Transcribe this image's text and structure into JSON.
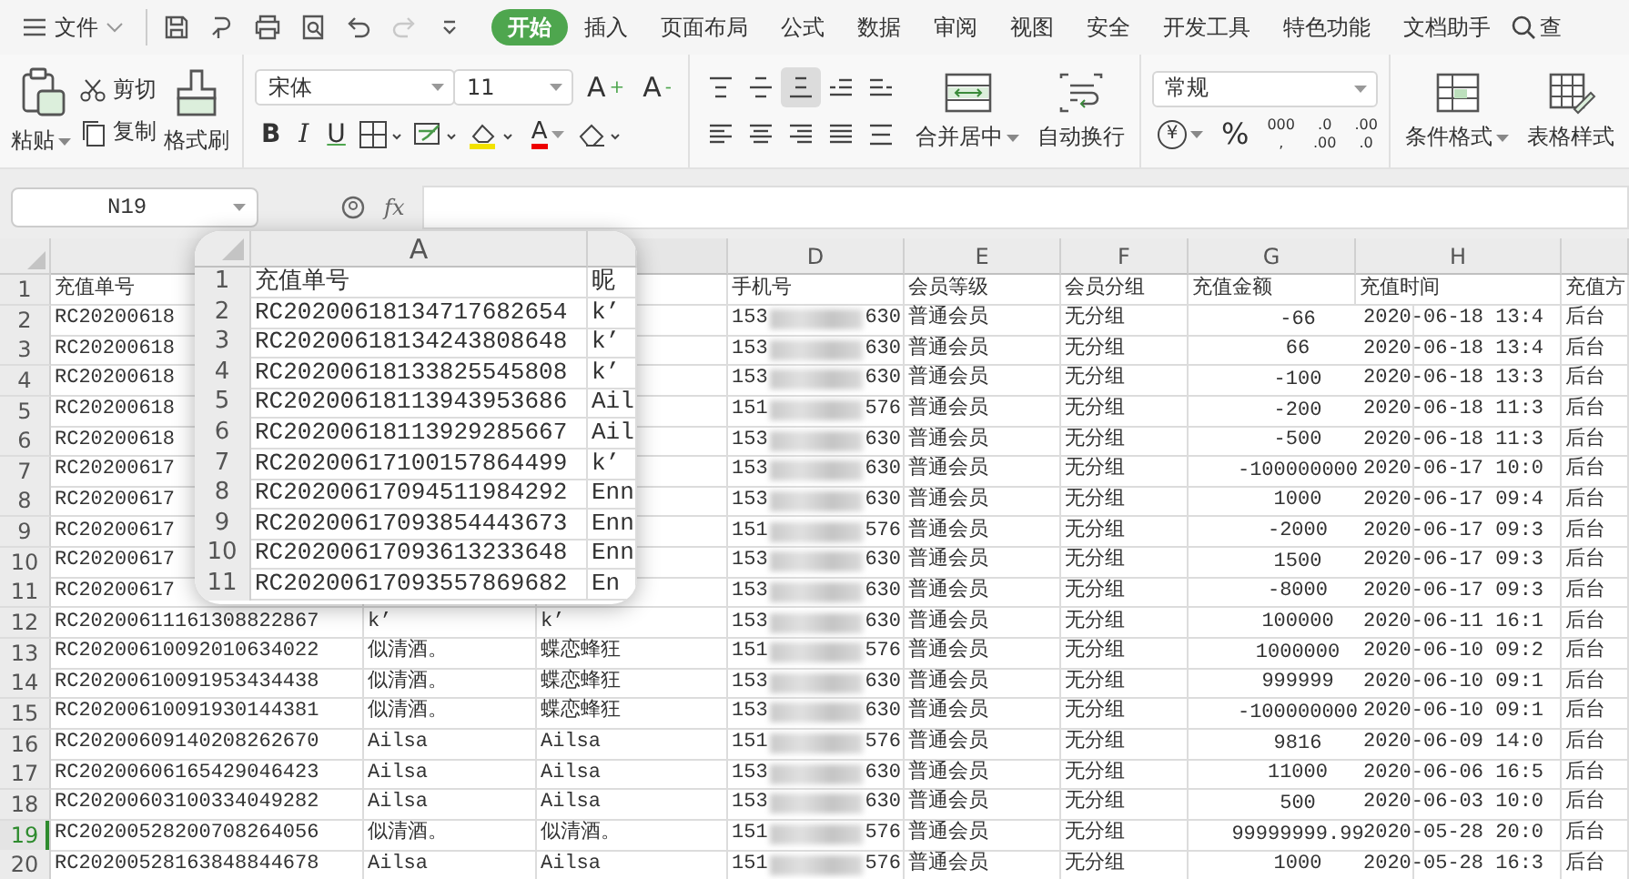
{
  "menu": {
    "label": "文件"
  },
  "quick_access": [
    {
      "kind": "save",
      "disabled": false
    },
    {
      "kind": "export",
      "disabled": false
    },
    {
      "kind": "print",
      "disabled": false
    },
    {
      "kind": "preview",
      "disabled": false
    },
    {
      "kind": "undo",
      "disabled": false
    },
    {
      "kind": "redo",
      "disabled": true
    },
    {
      "kind": "more",
      "disabled": false
    }
  ],
  "tabs": [
    {
      "label": "开始",
      "selected": true
    },
    {
      "label": "插入",
      "selected": false
    },
    {
      "label": "页面布局",
      "selected": false
    },
    {
      "label": "公式",
      "selected": false
    },
    {
      "label": "数据",
      "selected": false
    },
    {
      "label": "审阅",
      "selected": false
    },
    {
      "label": "视图",
      "selected": false
    },
    {
      "label": "安全",
      "selected": false
    },
    {
      "label": "开发工具",
      "selected": false
    },
    {
      "label": "特色功能",
      "selected": false
    },
    {
      "label": "文档助手",
      "selected": false
    }
  ],
  "search": {
    "label": "查"
  },
  "ribbon": {
    "clipboard": {
      "paste": "粘贴",
      "cut": "剪切",
      "copy": "复制",
      "format_painter": "格式刷"
    },
    "font": {
      "name": "宋体",
      "size": "11",
      "grow": "A",
      "grow_mark": "+",
      "shrink": "A",
      "shrink_mark": "-",
      "bold": "B",
      "italic": "I",
      "underline": "U",
      "font_color_letter": "A"
    },
    "alignment": {
      "buttons": [
        {
          "kind": "top",
          "selected": false
        },
        {
          "kind": "middle",
          "selected": false
        },
        {
          "kind": "bottom",
          "selected": true
        },
        {
          "kind": "indent-less",
          "selected": false
        },
        {
          "kind": "indent-more",
          "selected": false
        },
        {
          "kind": "left",
          "selected": false
        },
        {
          "kind": "center",
          "selected": false
        },
        {
          "kind": "right",
          "selected": false
        },
        {
          "kind": "justify",
          "selected": false
        },
        {
          "kind": "distribute",
          "selected": false
        }
      ],
      "merge": "合并居中",
      "wrap": "自动换行"
    },
    "number": {
      "format": "常规",
      "currency": "¥",
      "percent": "%",
      "thousands": [
        "000",
        ","
      ],
      "add_decimal": [
        ".0",
        ".00"
      ],
      "remove_decimal": [
        ".00",
        ".0"
      ]
    },
    "styles": {
      "conditional": "条件格式",
      "table_style": "表格样式"
    }
  },
  "formula_bar": {
    "name_box": "N19",
    "fx": "fx"
  },
  "column_headers": [
    "D",
    "E",
    "F",
    "G",
    "H"
  ],
  "rows": [
    {
      "num": "1",
      "kind": "header",
      "selected": false,
      "a": "充值单号",
      "phone": "手机号",
      "level": "会员等级",
      "group": "会员分组",
      "amount": "充值金额",
      "time": "充值时间",
      "method": "充值方"
    },
    {
      "num": "2",
      "kind": "record",
      "selected": false,
      "a": "RC20200618",
      "phone": "153",
      "phone_end": "630",
      "level": "普通会员",
      "group": "无分组",
      "amount": "-66",
      "time": "2020-06-18 13:4",
      "method": "后台"
    },
    {
      "num": "3",
      "kind": "record",
      "selected": false,
      "a": "RC20200618",
      "phone": "153",
      "phone_end": "630",
      "level": "普通会员",
      "group": "无分组",
      "amount": "66",
      "time": "2020-06-18 13:4",
      "method": "后台"
    },
    {
      "num": "4",
      "kind": "record",
      "selected": false,
      "a": "RC20200618",
      "phone": "153",
      "phone_end": "630",
      "level": "普通会员",
      "group": "无分组",
      "amount": "-100",
      "time": "2020-06-18 13:3",
      "method": "后台"
    },
    {
      "num": "5",
      "kind": "record",
      "selected": false,
      "a": "RC20200618",
      "phone": "151",
      "phone_end": "576",
      "level": "普通会员",
      "group": "无分组",
      "amount": "-200",
      "time": "2020-06-18 11:3",
      "method": "后台"
    },
    {
      "num": "6",
      "kind": "record",
      "selected": false,
      "a": "RC20200618",
      "phone": "153",
      "phone_end": "630",
      "level": "普通会员",
      "group": "无分组",
      "amount": "-500",
      "time": "2020-06-18 11:3",
      "method": "后台"
    },
    {
      "num": "7",
      "kind": "record",
      "selected": false,
      "a": "RC20200617",
      "phone": "153",
      "phone_end": "630",
      "level": "普通会员",
      "group": "无分组",
      "amount": "-100000000",
      "time": "2020-06-17 10:0",
      "method": "后台"
    },
    {
      "num": "8",
      "kind": "record",
      "selected": false,
      "a": "RC20200617",
      "phone": "153",
      "phone_end": "630",
      "level": "普通会员",
      "group": "无分组",
      "amount": "1000",
      "time": "2020-06-17 09:4",
      "method": "后台"
    },
    {
      "num": "9",
      "kind": "record",
      "selected": false,
      "a": "RC20200617",
      "phone": "151",
      "phone_end": "576",
      "level": "普通会员",
      "group": "无分组",
      "amount": "-2000",
      "time": "2020-06-17 09:3",
      "method": "后台"
    },
    {
      "num": "10",
      "kind": "record",
      "selected": false,
      "a": "RC20200617",
      "phone": "153",
      "phone_end": "630",
      "level": "普通会员",
      "group": "无分组",
      "amount": "1500",
      "time": "2020-06-17 09:3",
      "method": "后台"
    },
    {
      "num": "11",
      "kind": "record",
      "selected": false,
      "a": "RC20200617",
      "phone": "153",
      "phone_end": "630",
      "level": "普通会员",
      "group": "无分组",
      "amount": "-8000",
      "time": "2020-06-17 09:3",
      "method": "后台"
    },
    {
      "num": "12",
      "kind": "record",
      "selected": false,
      "a": "RC20200611161308822867",
      "b": "k’",
      "c": "k’",
      "phone": "153",
      "phone_end": "630",
      "level": "普通会员",
      "group": "无分组",
      "amount": "100000",
      "time": "2020-06-11 16:1",
      "method": "后台"
    },
    {
      "num": "13",
      "kind": "record",
      "selected": false,
      "a": "RC20200610092010634022",
      "b": "似清酒。",
      "c": "蝶恋蜂狂",
      "phone": "151",
      "phone_end": "576",
      "level": "普通会员",
      "group": "无分组",
      "amount": "1000000",
      "time": "2020-06-10 09:2",
      "method": "后台"
    },
    {
      "num": "14",
      "kind": "record",
      "selected": false,
      "a": "RC20200610091953434438",
      "b": "似清酒。",
      "c": "蝶恋蜂狂",
      "phone": "153",
      "phone_end": "630",
      "level": "普通会员",
      "group": "无分组",
      "amount": "999999",
      "time": "2020-06-10 09:1",
      "method": "后台"
    },
    {
      "num": "15",
      "kind": "record",
      "selected": false,
      "a": "RC20200610091930144381",
      "b": "似清酒。",
      "c": "蝶恋蜂狂",
      "phone": "153",
      "phone_end": "630",
      "level": "普通会员",
      "group": "无分组",
      "amount": "-100000000",
      "time": "2020-06-10 09:1",
      "method": "后台"
    },
    {
      "num": "16",
      "kind": "record",
      "selected": false,
      "a": "RC20200609140208262670",
      "b": "Ailsa",
      "c": "Ailsa",
      "phone": "151",
      "phone_end": "576",
      "level": "普通会员",
      "group": "无分组",
      "amount": "9816",
      "time": "2020-06-09 14:0",
      "method": "后台"
    },
    {
      "num": "17",
      "kind": "record",
      "selected": false,
      "a": "RC20200606165429046423",
      "b": "Ailsa",
      "c": "Ailsa",
      "phone": "153",
      "phone_end": "630",
      "level": "普通会员",
      "group": "无分组",
      "amount": "11000",
      "time": "2020-06-06 16:5",
      "method": "后台"
    },
    {
      "num": "18",
      "kind": "record",
      "selected": false,
      "a": "RC20200603100334049282",
      "b": "Ailsa",
      "c": "Ailsa",
      "phone": "153",
      "phone_end": "630",
      "level": "普通会员",
      "group": "无分组",
      "amount": "500",
      "time": "2020-06-03 10:0",
      "method": "后台"
    },
    {
      "num": "19",
      "kind": "record",
      "selected": true,
      "a": "RC20200528200708264056",
      "b": "似清酒。",
      "c": "似清酒。",
      "phone": "151",
      "phone_end": "576",
      "level": "普通会员",
      "group": "无分组",
      "amount": "99999999.99",
      "time": "2020-05-28 20:0",
      "method": "后台"
    },
    {
      "num": "20",
      "kind": "record",
      "selected": false,
      "a": "RC20200528163848844678",
      "b": "Ailsa",
      "c": "Ailsa",
      "phone": "151",
      "phone_end": "576",
      "level": "普通会员",
      "group": "无分组",
      "amount": "1000",
      "time": "2020-05-28 16:3",
      "method": "后台"
    }
  ],
  "magnifier": {
    "column": "A",
    "rows": [
      {
        "num": "1",
        "a": "充值单号",
        "b": "昵"
      },
      {
        "num": "2",
        "a": "RC20200618134717682654",
        "b": "k’"
      },
      {
        "num": "3",
        "a": "RC20200618134243808648",
        "b": "k’"
      },
      {
        "num": "4",
        "a": "RC20200618133825545808",
        "b": "k’"
      },
      {
        "num": "5",
        "a": "RC20200618113943953686",
        "b": "Ail"
      },
      {
        "num": "6",
        "a": "RC20200618113929285667",
        "b": "Ail"
      },
      {
        "num": "7",
        "a": "RC20200617100157864499",
        "b": "k’"
      },
      {
        "num": "8",
        "a": "RC20200617094511984292",
        "b": "Enn"
      },
      {
        "num": "9",
        "a": "RC20200617093854443673",
        "b": "Enn"
      },
      {
        "num": "10",
        "a": "RC20200617093613233648",
        "b": "Enn"
      },
      {
        "num": "11",
        "a": "RC20200617093557869682",
        "b": "En"
      }
    ]
  }
}
